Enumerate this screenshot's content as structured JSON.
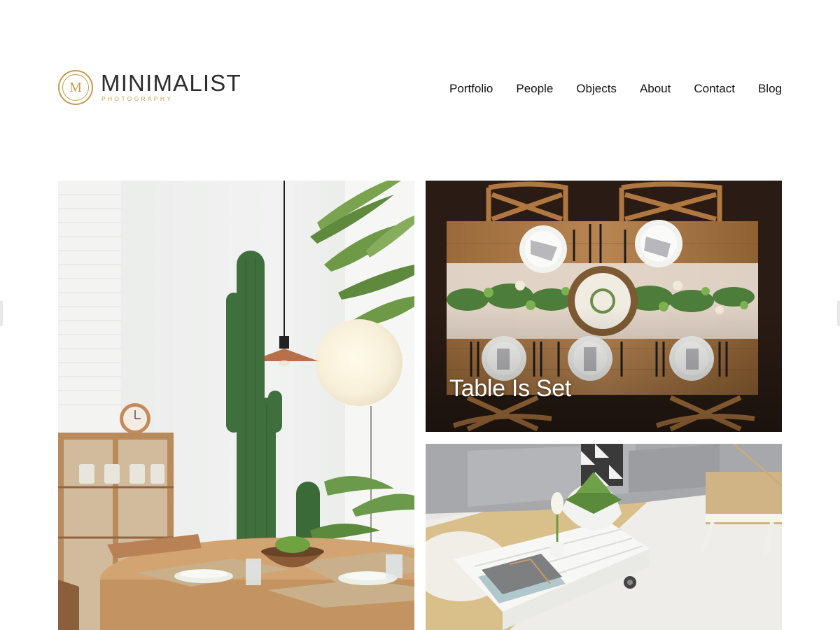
{
  "brand": {
    "monogram": "M",
    "title": "MINIMALIST",
    "subtitle": "PHOTOGRAPHY",
    "accent_color": "#c99a45"
  },
  "nav": {
    "items": [
      {
        "label": "Portfolio"
      },
      {
        "label": "People"
      },
      {
        "label": "Objects"
      },
      {
        "label": "About"
      },
      {
        "label": "Contact"
      },
      {
        "label": "Blog"
      }
    ]
  },
  "gallery": {
    "tiles": [
      {
        "caption": ""
      },
      {
        "caption": "Table Is Set"
      },
      {
        "caption": ""
      }
    ]
  }
}
